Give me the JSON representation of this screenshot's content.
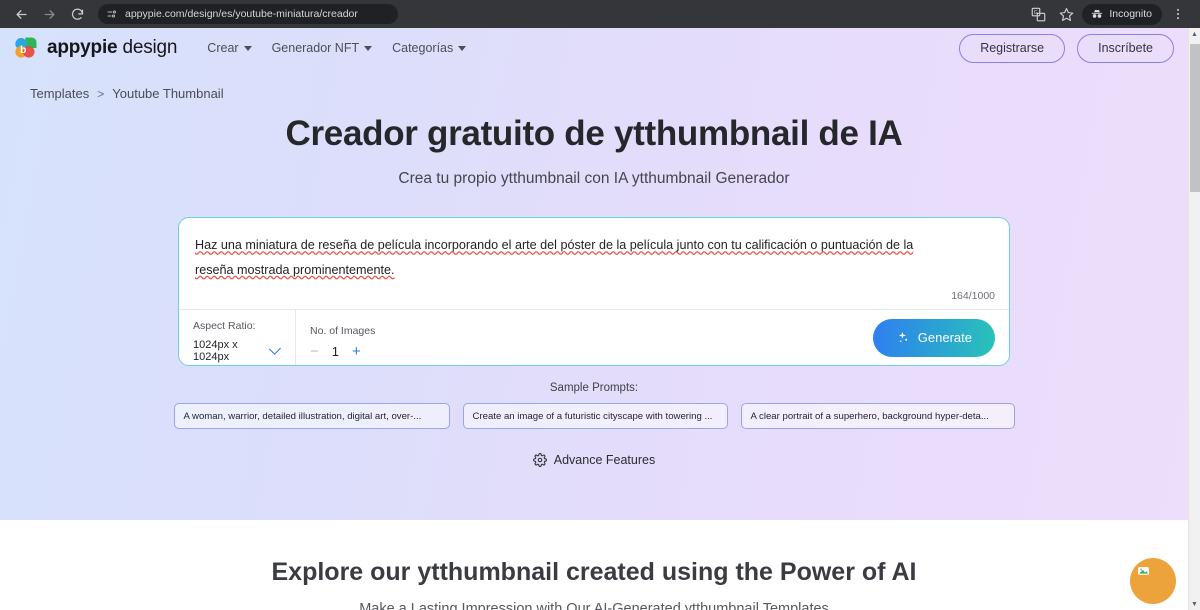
{
  "browser": {
    "back_icon": "arrow-left-icon",
    "forward_icon": "arrow-right-icon",
    "reload_icon": "reload-icon",
    "site_info_icon": "page-info-icon",
    "url": "appypie.com/design/es/youtube-miniatura/creador",
    "translate_icon": "translate-icon",
    "bookmark_icon": "star-icon",
    "incognito_label": "Incognito",
    "incognito_icon": "incognito-icon",
    "menu_icon": "three-dot-menu-icon"
  },
  "header": {
    "logo_icon": "appypie-logo-icon",
    "logo_brand": "appypie",
    "logo_product": "design",
    "nav": [
      {
        "label": "Crear",
        "caret": "chevron-down-icon"
      },
      {
        "label": "Generador NFT",
        "caret": "chevron-down-icon"
      },
      {
        "label": "Categorías",
        "caret": "chevron-down-icon"
      }
    ],
    "register_label": "Registrarse",
    "signup_label": "Inscríbete"
  },
  "breadcrumb": {
    "root": "Templates",
    "separator": ">",
    "current": "Youtube Thumbnail"
  },
  "hero": {
    "title": "Creador gratuito de ytthumbnail de IA",
    "subtitle": "Crea tu propio ytthumbnail con IA ytthumbnail Generador"
  },
  "prompt_card": {
    "text_line1": "Haz una miniatura de reseña de película incorporando el arte del póster de la película junto con tu calificación o puntuación de la",
    "text_line2": "reseña mostrada prominentemente.",
    "char_count": "164/1000",
    "aspect_ratio_label": "Aspect Ratio:",
    "aspect_ratio_value": "1024px x 1024px",
    "aspect_ratio_caret": "chevron-down-icon",
    "images_label": "No. of Images",
    "decrement": "−",
    "count": "1",
    "increment": "+",
    "generate_label": "Generate",
    "generate_icon": "sparkle-icon"
  },
  "samples": {
    "label": "Sample Prompts:",
    "chips": [
      "A woman, warrior, detailed illustration, digital art, over-...",
      "Create an image of a futuristic cityscape with towering ...",
      "A clear portrait of a superhero, background hyper-deta..."
    ]
  },
  "advance": {
    "icon": "gear-icon",
    "label": "Advance Features"
  },
  "lower": {
    "title": "Explore our ytthumbnail created using the Power of AI",
    "subtitle": "Make a Lasting Impression with Our AI-Generated ytthumbnail Templates"
  },
  "chat_widget": {
    "icon": "chat-widget-icon",
    "color": "#eda33c"
  },
  "colors": {
    "gradient_start": "#d6e2fc",
    "gradient_end": "#eddefb",
    "card_border": "#6fd0d8",
    "accent_blue": "#2c7be5",
    "pill_border": "#8c7fe8"
  }
}
